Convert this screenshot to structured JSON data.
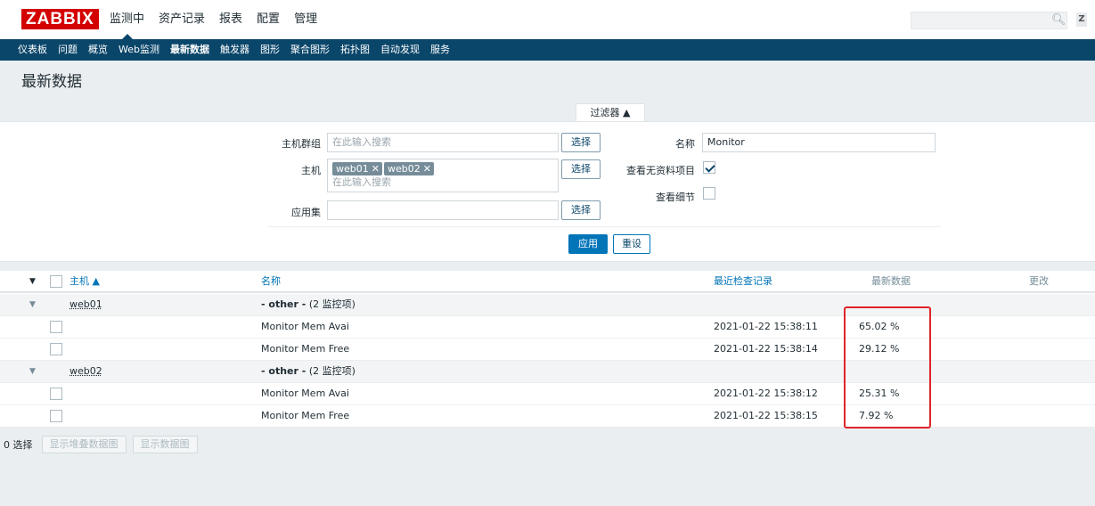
{
  "logo": "ZABBIX",
  "main_menu": [
    "监测中",
    "资产记录",
    "报表",
    "配置",
    "管理"
  ],
  "search": {
    "placeholder": "",
    "icon": "search-icon"
  },
  "edge_label": "Z",
  "sub_menu": [
    "仪表板",
    "问题",
    "概览",
    "Web监测",
    "最新数据",
    "触发器",
    "图形",
    "聚合图形",
    "拓扑图",
    "自动发现",
    "服务"
  ],
  "page_title": "最新数据",
  "filter": {
    "tab_label": "过滤器 ▲",
    "host_group_label": "主机群组",
    "host_group_placeholder": "在此输入搜索",
    "host_label": "主机",
    "host_tags": [
      "web01",
      "web02"
    ],
    "host_placeholder": "在此输入搜索",
    "application_label": "应用集",
    "application_value": "",
    "select_label": "选择",
    "name_label": "名称",
    "name_value": "Monitor",
    "show_no_data_label": "查看无资料项目",
    "show_no_data": true,
    "show_details_label": "查看细节",
    "show_details": false,
    "apply_label": "应用",
    "reset_label": "重设"
  },
  "table": {
    "headers": {
      "host": "主机 ▲",
      "name": "名称",
      "last_check": "最近检查记录",
      "last_value": "最新数据",
      "change": "更改"
    },
    "groups": [
      {
        "host": "web01",
        "group_title": "- other -",
        "group_count": "(2 监控项)",
        "items": [
          {
            "name": "Monitor Mem Avai",
            "last_check": "2021-01-22 15:38:11",
            "last_value": "65.02 %"
          },
          {
            "name": "Monitor Mem Free",
            "last_check": "2021-01-22 15:38:14",
            "last_value": "29.12 %"
          }
        ]
      },
      {
        "host": "web02",
        "group_title": "- other -",
        "group_count": "(2 监控项)",
        "items": [
          {
            "name": "Monitor Mem Avai",
            "last_check": "2021-01-22 15:38:12",
            "last_value": "25.31 %"
          },
          {
            "name": "Monitor Mem Free",
            "last_check": "2021-01-22 15:38:15",
            "last_value": "7.92 %"
          }
        ]
      }
    ]
  },
  "footer": {
    "selected_count": "0 选择",
    "stacked_graph_label": "显示堆叠数据图",
    "graph_label": "显示数据图"
  },
  "colors": {
    "logo_red": "#d40000",
    "nav_blue": "#0a466a",
    "link_blue": "#0275b8",
    "annotation_red": "#e0242a"
  }
}
